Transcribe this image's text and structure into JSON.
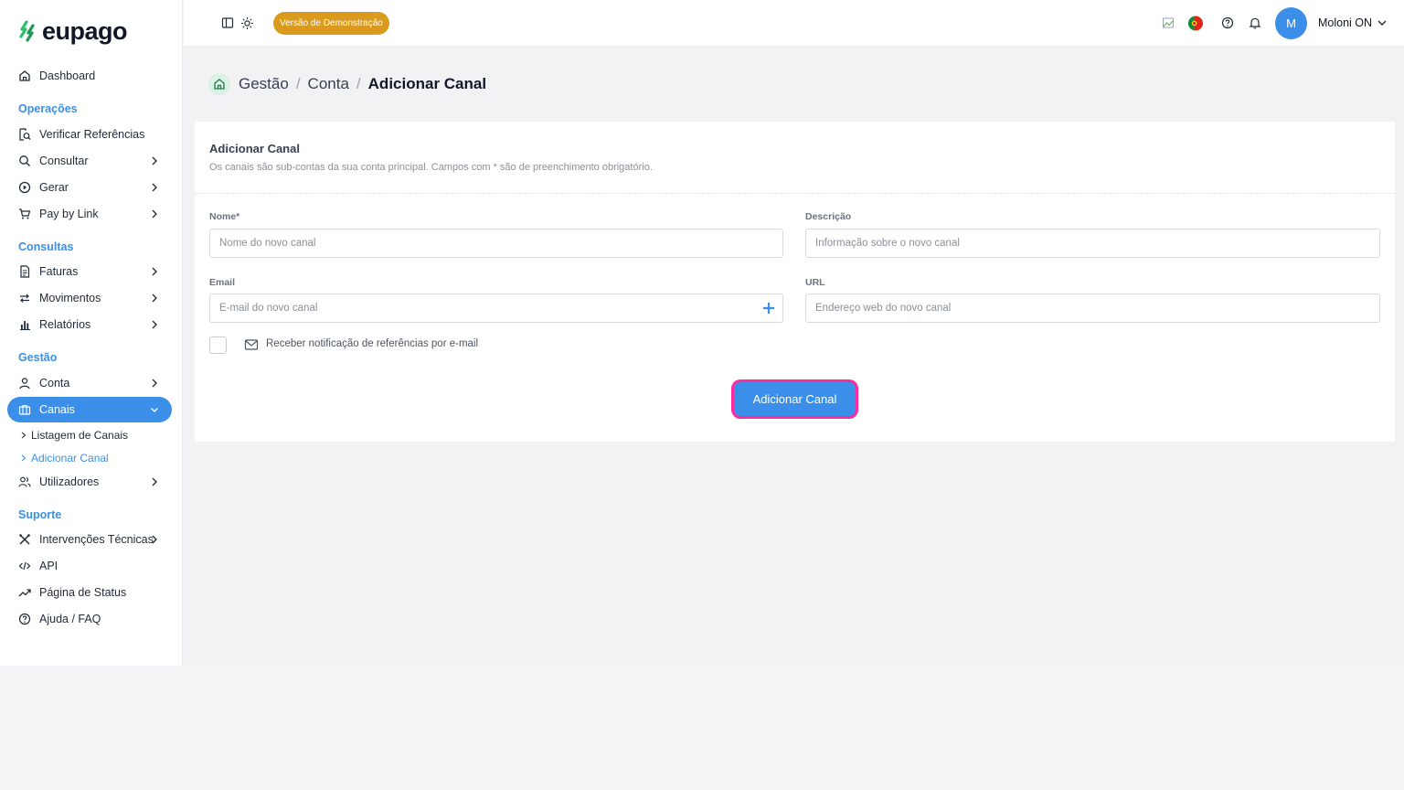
{
  "brand": {
    "name": "eupago",
    "colors": {
      "accent": "#3b8fe9",
      "logo_green": "#2bbf6e",
      "demo": "#d99a1e",
      "highlight": "#ff2aa0"
    }
  },
  "sidebar": {
    "dashboard": "Dashboard",
    "sections": {
      "operacoes": "Operações",
      "consultas": "Consultas",
      "gestao": "Gestão",
      "suporte": "Suporte"
    },
    "items": {
      "verificar": "Verificar Referências",
      "consultar": "Consultar",
      "gerar": "Gerar",
      "paybylink": "Pay by Link",
      "faturas": "Faturas",
      "movimentos": "Movimentos",
      "relatorios": "Relatórios",
      "conta": "Conta",
      "canais": "Canais",
      "utilizadores": "Utilizadores",
      "intervencoes": "Intervenções Técnicas",
      "api": "API",
      "status": "Página de Status",
      "ajuda": "Ajuda / FAQ"
    },
    "canais_sub": {
      "listagem": "Listagem de Canais",
      "adicionar": "Adicionar Canal"
    }
  },
  "topbar": {
    "demo_badge": "Versão de Demonstração",
    "avatar_initial": "M",
    "user_name": "Moloni ON",
    "icons": [
      "sidebar-toggle-icon",
      "sun-icon",
      "broken-image-icon",
      "portugal-flag-icon",
      "help-icon",
      "bell-icon",
      "chevron-down-icon"
    ]
  },
  "breadcrumb": {
    "items": [
      "Gestão",
      "Conta"
    ],
    "separator": "/",
    "current": "Adicionar Canal"
  },
  "form": {
    "title": "Adicionar Canal",
    "subtitle": "Os canais são sub-contas da sua conta principal. Campos com *  são de preenchimento obrigatório.",
    "nome": {
      "label": "Nome*",
      "placeholder": "Nome do novo canal",
      "value": ""
    },
    "descricao": {
      "label": "Descrição",
      "placeholder": "Informação sobre o novo canal",
      "value": ""
    },
    "email": {
      "label": "Email",
      "placeholder": "E-mail do novo canal",
      "value": ""
    },
    "url": {
      "label": "URL",
      "placeholder": "Endereço web do novo canal",
      "value": ""
    },
    "notify_label": "Receber notificação de referências por e-mail",
    "submit": "Adicionar Canal"
  }
}
